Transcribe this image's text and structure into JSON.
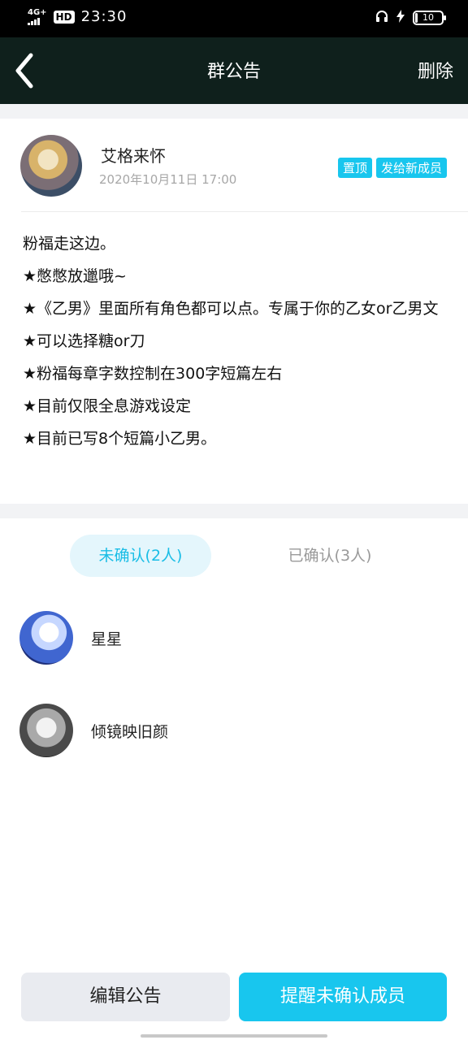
{
  "status_bar": {
    "network": "4G+",
    "hd": "HD",
    "time": "23:30",
    "battery": "10",
    "battery_level": 0.1
  },
  "nav": {
    "title": "群公告",
    "action": "删除"
  },
  "author": {
    "name": "艾格来怀",
    "time": "2020年10月11日 17:00",
    "tags": [
      "置顶",
      "发给新成员"
    ]
  },
  "content": {
    "lines": [
      "粉福走这边。",
      "★憋憋放邋哦~",
      "★《乙男》里面所有角色都可以点。专属于你的乙女or乙男文",
      "★可以选择糖or刀",
      "★粉福每章字数控制在300字短篇左右",
      "★目前仅限全息游戏设定",
      "★目前已写8个短篇小乙男。"
    ]
  },
  "tabs": {
    "unconfirmed": "未确认(2人)",
    "confirmed": "已确认(3人)"
  },
  "members": [
    {
      "name": "星星"
    },
    {
      "name": "倾镜映旧颜"
    }
  ],
  "buttons": {
    "edit": "编辑公告",
    "remind": "提醒未确认成员"
  },
  "colors": {
    "accent": "#18c6ee",
    "nav_bg": "#0f201c"
  },
  "icons": {
    "back": "chevron-left-icon",
    "headphones": "headphones-icon",
    "charging": "lightning-icon"
  }
}
